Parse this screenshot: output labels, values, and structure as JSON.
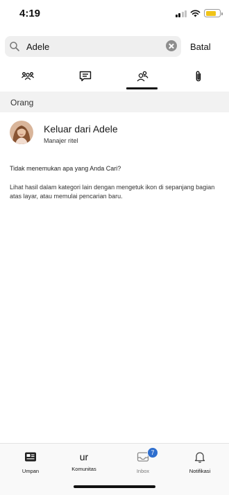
{
  "status_bar": {
    "time": "4:19"
  },
  "search": {
    "query": "Adele",
    "cancel_label": "Batal"
  },
  "tabs": [
    {
      "icon": "group-icon"
    },
    {
      "icon": "message-icon"
    },
    {
      "icon": "people-icon",
      "selected": true
    },
    {
      "icon": "attachment-icon"
    }
  ],
  "section": {
    "title": "Orang"
  },
  "person": {
    "name": "Keluar dari Adele",
    "title": "Manajer ritel"
  },
  "empty_message": {
    "line1": "Tidak menemukan apa yang Anda Cari?",
    "line2": "Lihat hasil dalam kategori lain dengan mengetuk ikon di sepanjang bagian atas layar, atau memulai pencarian baru."
  },
  "bottom_nav": {
    "items": [
      {
        "label": "Umpan",
        "icon": "feed-icon"
      },
      {
        "label": "Komunitas",
        "glyph": "ur"
      },
      {
        "label": "Inbox",
        "icon": "inbox-icon",
        "badge": "7"
      },
      {
        "label": "Notifikasi",
        "icon": "bell-icon"
      }
    ]
  },
  "colors": {
    "accent": "#2f6fce",
    "battery": "#f0c419",
    "section_bg": "#f2f2f2"
  }
}
